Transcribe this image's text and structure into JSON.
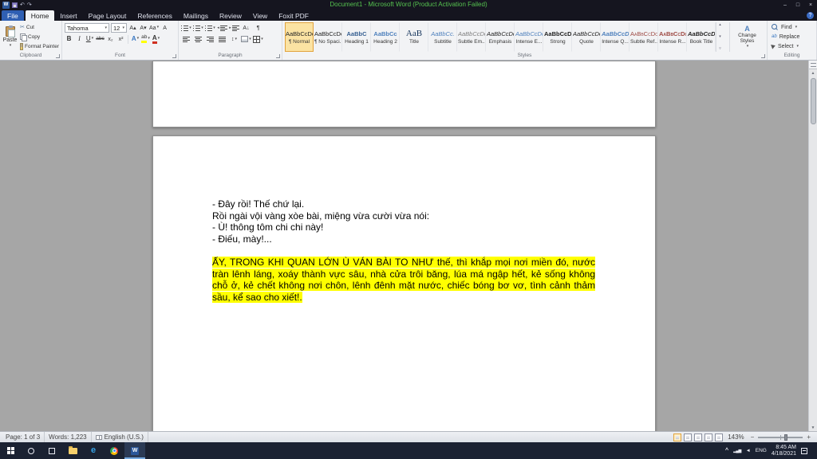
{
  "window": {
    "title": "Document1 - Microsoft Word (Product Activation Failed)"
  },
  "icons": {
    "word_logo": "W",
    "minimize": "–",
    "maximize": "□",
    "close": "×",
    "undo": "↶",
    "redo": "↷",
    "help": "?",
    "cut_glyph": "✂",
    "bold": "B",
    "italic": "I",
    "underline": "U",
    "strikethrough": "abc",
    "subscript": "x₂",
    "superscript": "x²",
    "grow_font": "A▴",
    "shrink_font": "A▾",
    "change_case": "Aa",
    "clear_formatting": "A",
    "text_effects": "A",
    "highlight": "ab",
    "font_color": "A",
    "sort": "A↓",
    "pilcrow": "¶",
    "line_spacing": "↕",
    "replace_icon": "ab",
    "change_styles_icon": "A",
    "zoom_out": "−",
    "zoom_in": "+",
    "chevron_up": "^",
    "network": "▂▄▆",
    "volume": "◄",
    "edge": "e"
  },
  "tabs": [
    {
      "label": "File"
    },
    {
      "label": "Home"
    },
    {
      "label": "Insert"
    },
    {
      "label": "Page Layout"
    },
    {
      "label": "References"
    },
    {
      "label": "Mailings"
    },
    {
      "label": "Review"
    },
    {
      "label": "View"
    },
    {
      "label": "Foxit PDF"
    }
  ],
  "ribbon": {
    "clipboard": {
      "group_label": "Clipboard",
      "paste": "Paste",
      "cut": "Cut",
      "copy": "Copy",
      "format_painter": "Format Painter"
    },
    "font": {
      "group_label": "Font",
      "font_name": "Tahoma",
      "font_size": "12"
    },
    "paragraph": {
      "group_label": "Paragraph"
    },
    "styles": {
      "group_label": "Styles",
      "change_styles": "Change Styles",
      "items": [
        {
          "preview": "AaBbCcDc",
          "name": "¶ Normal"
        },
        {
          "preview": "AaBbCcDc",
          "name": "¶ No Spaci..."
        },
        {
          "preview": "AaBbC",
          "name": "Heading 1"
        },
        {
          "preview": "AaBbCc",
          "name": "Heading 2"
        },
        {
          "preview": "AaB",
          "name": "Title"
        },
        {
          "preview": "AaBbCc.",
          "name": "Subtitle"
        },
        {
          "preview": "AaBbCcDc",
          "name": "Subtle Em..."
        },
        {
          "preview": "AaBbCcDc",
          "name": "Emphasis"
        },
        {
          "preview": "AaBbCcDc",
          "name": "Intense E..."
        },
        {
          "preview": "AaBbCcDc",
          "name": "Strong"
        },
        {
          "preview": "AaBbCcDc",
          "name": "Quote"
        },
        {
          "preview": "AaBbCcDc",
          "name": "Intense Q..."
        },
        {
          "preview": "AaBbCcDc",
          "name": "Subtle Ref..."
        },
        {
          "preview": "AaBbCcDc",
          "name": "Intense R..."
        },
        {
          "preview": "AaBbCcDc",
          "name": "Book Title"
        }
      ]
    },
    "editing": {
      "group_label": "Editing",
      "find": "Find",
      "replace": "Replace",
      "select": "Select"
    }
  },
  "document": {
    "lines": [
      "- Đây rồi! Thế chứ lại.",
      "Rồi ngài vội vàng xòe bài, miệng vừa cười vừa nói:",
      "- Ù! thông tôm chi chi này!",
      "- Điếu, mày!..."
    ],
    "highlight": "ẤY, TRONG KHI QUAN LỚN Ù VÁN BÀI TO NHƯ thế, thì khắp mọi nơi miền đó, nước tràn lênh láng, xoáy thành vực sâu, nhà cửa trôi băng, lúa má ngập hết, kẻ sống không chỗ ở, kẻ chết không nơi chôn, lênh đênh mặt nước, chiếc bóng bơ vơ, tình cảnh thảm sầu, kể sao cho xiết!."
  },
  "status_bar": {
    "page": "Page: 1 of 3",
    "words": "Words: 1,223",
    "language": "English (U.S.)",
    "zoom_level": "143%"
  },
  "taskbar": {
    "language": "ENG",
    "time": "8:45 AM",
    "date": "4/18/2021"
  }
}
